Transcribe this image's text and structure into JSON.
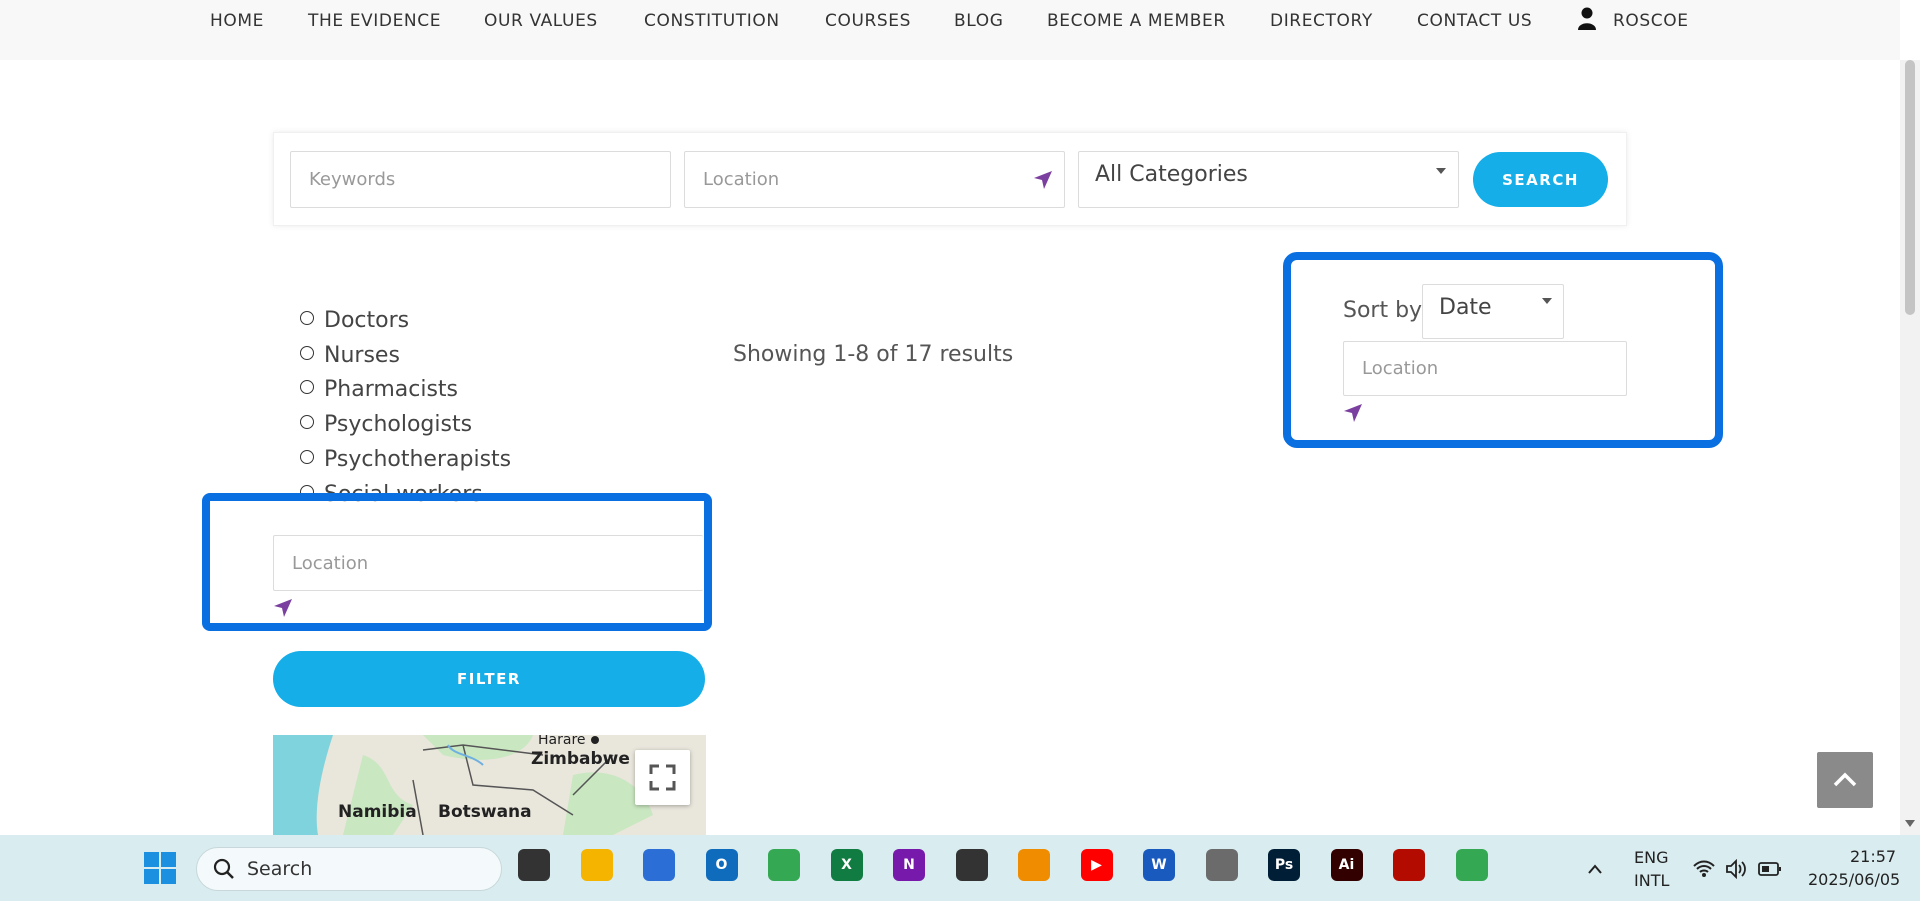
{
  "nav": {
    "items": [
      "HOME",
      "THE EVIDENCE",
      "OUR VALUES",
      "CONSTITUTION",
      "COURSES",
      "BLOG",
      "BECOME A MEMBER",
      "DIRECTORY",
      "CONTACT US"
    ],
    "user": "ROSCOE"
  },
  "search": {
    "keywords_placeholder": "Keywords",
    "location_placeholder": "Location",
    "category_value": "All Categories",
    "button": "SEARCH"
  },
  "filters": {
    "categories": [
      "Doctors",
      "Nurses",
      "Pharmacists",
      "Psychologists",
      "Psychotherapists",
      "Social workers"
    ],
    "location_placeholder": "Location",
    "filter_button": "FILTER"
  },
  "results": {
    "summary": "Showing 1-8 of 17 results"
  },
  "sort": {
    "label": "Sort by",
    "value": "Date",
    "location_placeholder": "Location"
  },
  "map": {
    "labels": [
      "Harare",
      "Zimbabwe",
      "Namibia",
      "Botswana"
    ]
  },
  "taskbar": {
    "search_label": "Search",
    "lang_top": "ENG",
    "lang_bottom": "INTL",
    "time": "21:57",
    "date": "2025/06/05",
    "apps": [
      {
        "name": "task-view-icon",
        "text": "",
        "color": "#333333"
      },
      {
        "name": "file-explorer-icon",
        "text": "",
        "color": "#f4b400"
      },
      {
        "name": "microsoft-store-icon",
        "text": "",
        "color": "#2b6fd6"
      },
      {
        "name": "outlook-icon",
        "text": "O",
        "color": "#0f6cbd"
      },
      {
        "name": "chrome-icon",
        "text": "",
        "color": "#34a853"
      },
      {
        "name": "excel-icon",
        "text": "X",
        "color": "#107c41"
      },
      {
        "name": "onenote-icon",
        "text": "N",
        "color": "#7719aa"
      },
      {
        "name": "sticky-notes-icon",
        "text": "",
        "color": "#333333"
      },
      {
        "name": "vlc-icon",
        "text": "",
        "color": "#f08c00"
      },
      {
        "name": "youtube-icon",
        "text": "▶",
        "color": "#ff0000"
      },
      {
        "name": "word-icon",
        "text": "W",
        "color": "#185abd"
      },
      {
        "name": "calculator-icon",
        "text": "",
        "color": "#6b6b6b"
      },
      {
        "name": "photoshop-icon",
        "text": "Ps",
        "color": "#001e36"
      },
      {
        "name": "illustrator-icon",
        "text": "Ai",
        "color": "#330000"
      },
      {
        "name": "acrobat-icon",
        "text": "",
        "color": "#b30b00"
      },
      {
        "name": "chrome-active-icon",
        "text": "",
        "color": "#34a853"
      }
    ]
  },
  "colors": {
    "accent": "#15aee8",
    "annotation": "#0a6fe0",
    "location_arrow": "#7b3fa0"
  }
}
